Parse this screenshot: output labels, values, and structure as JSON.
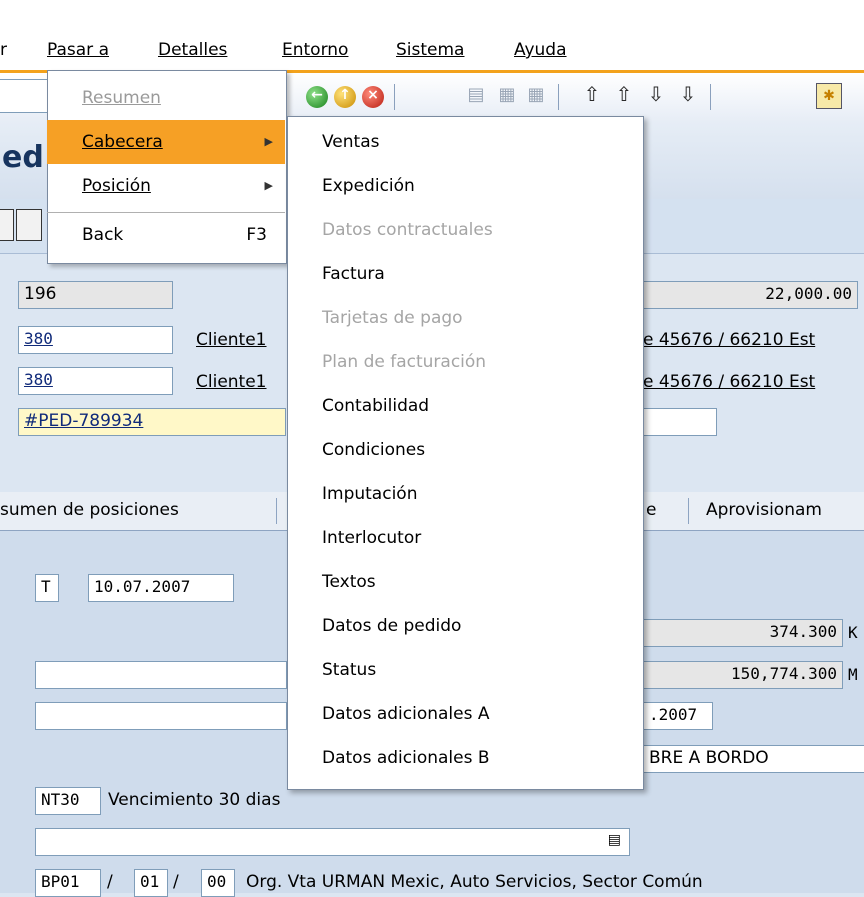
{
  "menubar": {
    "items": [
      {
        "label": "r",
        "underline": false
      },
      {
        "label": "Pasar a",
        "underline": true
      },
      {
        "label": "Detalles",
        "underline": true
      },
      {
        "label": "Entorno",
        "underline": true
      },
      {
        "label": "Sistema",
        "underline": true
      },
      {
        "label": "Ayuda",
        "underline": true
      }
    ]
  },
  "toolbar": {
    "icons": [
      "back-icon",
      "exit-icon",
      "cancel-icon",
      "print-icon",
      "find-icon",
      "find-next-icon",
      "first-page-icon",
      "previous-page-icon",
      "next-page-icon",
      "last-page-icon",
      "new-session-icon"
    ]
  },
  "title": {
    "text": "ed"
  },
  "fields": {
    "field_196": "196",
    "amount": "22,000.00",
    "sold_to": "380",
    "sold_to_name": "Cliente1",
    "sold_to_address": "e 45676 / 66210 Est",
    "ship_to": "380",
    "ship_to_name": "Cliente1",
    "ship_to_address": "e 45676 / 66210 Est",
    "po_number": "#PED-789934"
  },
  "tabs": {
    "tab1": "sumen de posiciones",
    "tab2": "e",
    "tab3": "Aprovisionam"
  },
  "detail": {
    "t_field": "T",
    "date": "10.07.2007",
    "weight": "374.300",
    "weight_unit": "K",
    "volume": "150,774.300",
    "volume_unit": "M",
    "date2": ".2007",
    "incoterms_desc": "BRE A BORDO",
    "payment_terms": "NT30",
    "payment_terms_desc": "Vencimiento 30 dias",
    "org1": "BP01",
    "org_sep1": "/",
    "org2": "01",
    "org_sep2": "/",
    "org3": "00",
    "org_desc": "Org. Vta URMAN Mexic, Auto Servicios, Sector Común"
  },
  "pasar_menu": {
    "items": [
      {
        "label": "Resumen",
        "disabled": true
      },
      {
        "label": "Cabecera",
        "selected": true,
        "submenu": true
      },
      {
        "label": "Posición",
        "submenu": true
      },
      {
        "label": "Back",
        "shortcut": "F3"
      }
    ]
  },
  "cabecera_menu": {
    "items": [
      {
        "label": "Ventas"
      },
      {
        "label": "Expedición"
      },
      {
        "label": "Datos contractuales",
        "disabled": true
      },
      {
        "label": "Factura"
      },
      {
        "label": "Tarjetas de pago",
        "disabled": true
      },
      {
        "label": "Plan de facturación",
        "disabled": true
      },
      {
        "label": "Contabilidad"
      },
      {
        "label": "Condiciones"
      },
      {
        "label": "Imputación"
      },
      {
        "label": "Interlocutor"
      },
      {
        "label": "Textos"
      },
      {
        "label": "Datos de pedido"
      },
      {
        "label": "Status"
      },
      {
        "label": "Datos adicionales A"
      },
      {
        "label": "Datos adicionales B"
      }
    ]
  },
  "colors": {
    "menu_selected": "#f6a025",
    "accent_line": "#f3a21c",
    "background": "#dce6f2"
  }
}
